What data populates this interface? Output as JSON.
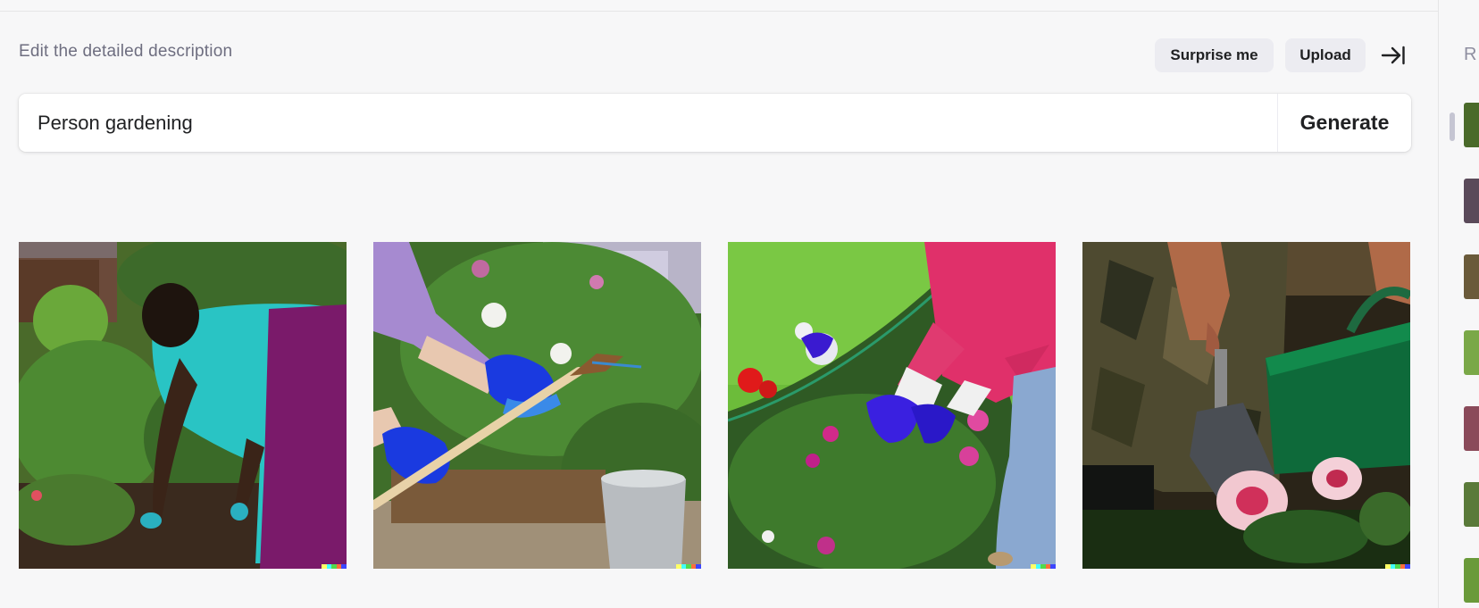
{
  "header": {
    "label": "Edit the detailed description",
    "surprise_label": "Surprise me",
    "upload_label": "Upload"
  },
  "prompt": {
    "value": "Person gardening",
    "generate_label": "Generate"
  },
  "images": [
    {
      "subject": "gardener in teal shirt and purple apron bending over garden bed"
    },
    {
      "subject": "hands in blue gloves holding a garden tool near flowers"
    },
    {
      "subject": "hands in purple gloves tending flowers in pink shirt"
    },
    {
      "subject": "person holding trowel and green watering can near pink flowers"
    }
  ],
  "history_panel": {
    "title_partial": "R"
  },
  "colors": {
    "background": "#f7f7f8",
    "button_bg": "#ececf1",
    "text": "#202123",
    "muted": "#6e6e80"
  }
}
